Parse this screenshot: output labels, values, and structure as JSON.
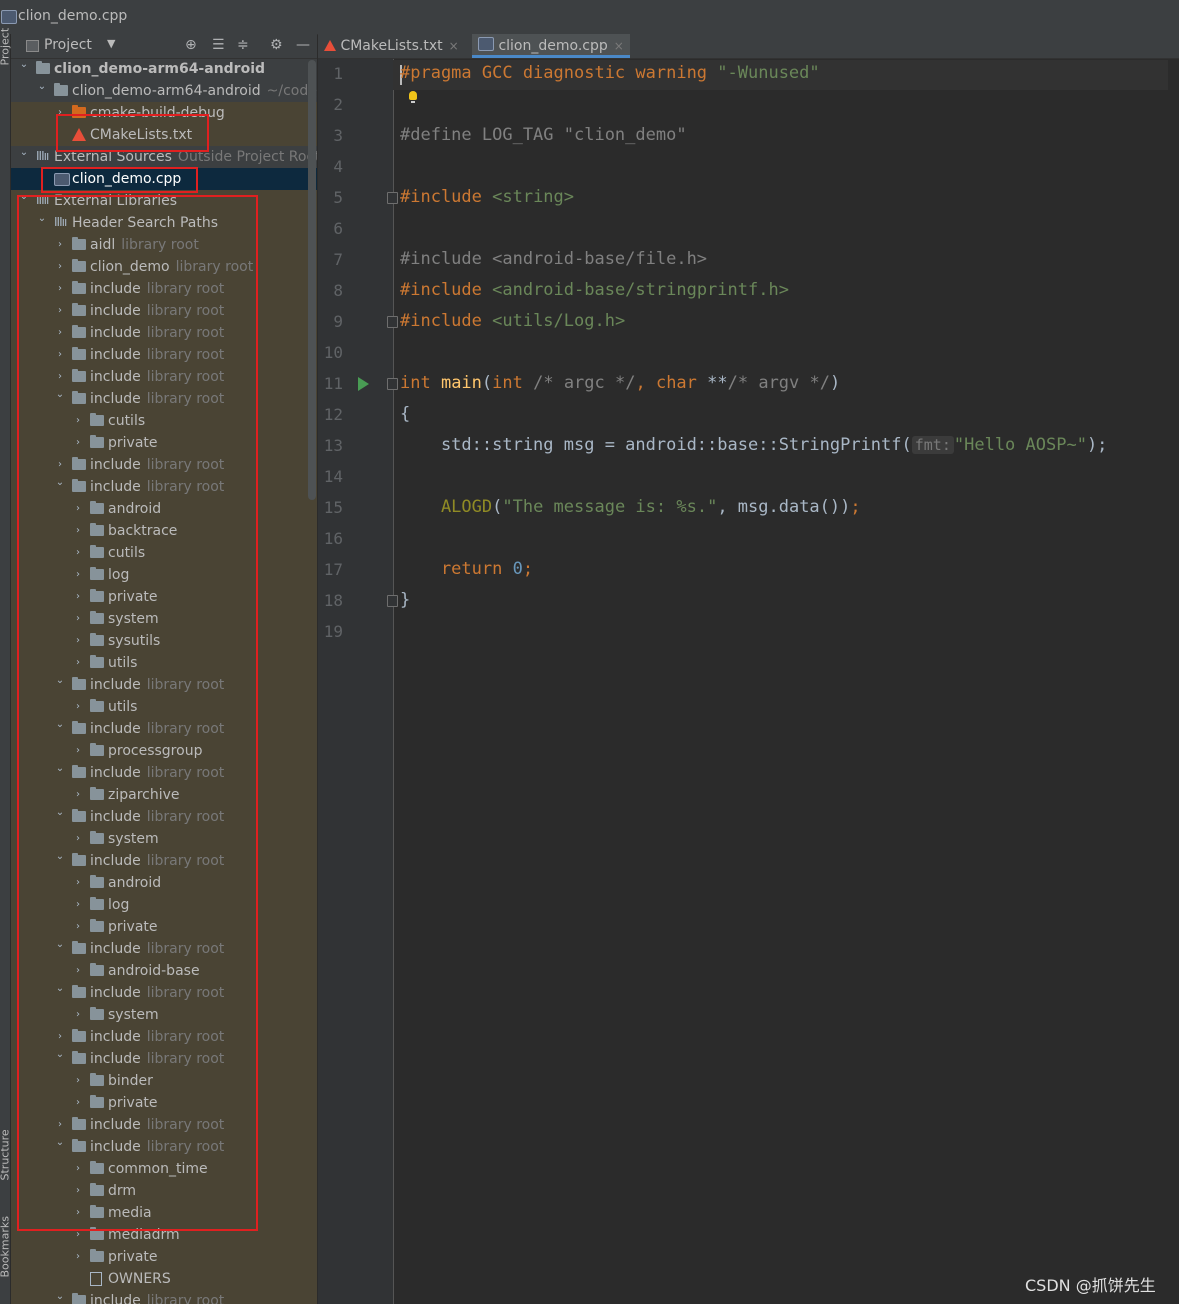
{
  "window": {
    "title": "clion_demo.cpp"
  },
  "side_strip": {
    "project": "Project",
    "structure": "Structure",
    "bookmarks": "Bookmarks"
  },
  "project_panel": {
    "title": "Project",
    "dropdown_icon": "caret-down-icon",
    "toolbar_icons": [
      "locate-icon",
      "expand-all-icon",
      "collapse-all-icon",
      "gear-icon",
      "minimize-icon"
    ],
    "tree": [
      {
        "name": "clion_demo-arm64-android",
        "hint": "",
        "icon": "module-folder"
      },
      {
        "name": "clion_demo-arm64-android",
        "hint": "~/code/c",
        "icon": "folder"
      },
      {
        "name": "cmake-build-debug",
        "hint": "",
        "icon": "excluded-folder"
      },
      {
        "name": "CMakeLists.txt",
        "hint": "",
        "icon": "cmake-file"
      },
      {
        "name": "External Sources",
        "hint": "Outside Project Root",
        "icon": "libraries"
      },
      {
        "name": "clion_demo.cpp",
        "hint": "",
        "icon": "cpp-file"
      },
      {
        "name": "External Libraries",
        "hint": "",
        "icon": "libraries"
      },
      {
        "name": "Header Search Paths",
        "hint": "",
        "icon": "libraries"
      },
      {
        "name": "aidl",
        "hint": "library root",
        "icon": "folder"
      },
      {
        "name": "clion_demo",
        "hint": "library root",
        "icon": "folder"
      },
      {
        "name": "include",
        "hint": "library root",
        "icon": "folder"
      },
      {
        "name": "include",
        "hint": "library root",
        "icon": "folder"
      },
      {
        "name": "include",
        "hint": "library root",
        "icon": "folder"
      },
      {
        "name": "include",
        "hint": "library root",
        "icon": "folder"
      },
      {
        "name": "include",
        "hint": "library root",
        "icon": "folder"
      },
      {
        "name": "include",
        "hint": "library root",
        "icon": "folder"
      },
      {
        "name": "cutils",
        "hint": "",
        "icon": "folder"
      },
      {
        "name": "private",
        "hint": "",
        "icon": "folder"
      },
      {
        "name": "include",
        "hint": "library root",
        "icon": "folder"
      },
      {
        "name": "include",
        "hint": "library root",
        "icon": "folder"
      },
      {
        "name": "android",
        "hint": "",
        "icon": "folder"
      },
      {
        "name": "backtrace",
        "hint": "",
        "icon": "folder"
      },
      {
        "name": "cutils",
        "hint": "",
        "icon": "folder"
      },
      {
        "name": "log",
        "hint": "",
        "icon": "folder"
      },
      {
        "name": "private",
        "hint": "",
        "icon": "folder"
      },
      {
        "name": "system",
        "hint": "",
        "icon": "folder"
      },
      {
        "name": "sysutils",
        "hint": "",
        "icon": "folder"
      },
      {
        "name": "utils",
        "hint": "",
        "icon": "folder"
      },
      {
        "name": "include",
        "hint": "library root",
        "icon": "folder"
      },
      {
        "name": "utils",
        "hint": "",
        "icon": "folder"
      },
      {
        "name": "include",
        "hint": "library root",
        "icon": "folder"
      },
      {
        "name": "processgroup",
        "hint": "",
        "icon": "folder"
      },
      {
        "name": "include",
        "hint": "library root",
        "icon": "folder"
      },
      {
        "name": "ziparchive",
        "hint": "",
        "icon": "folder"
      },
      {
        "name": "include",
        "hint": "library root",
        "icon": "folder"
      },
      {
        "name": "system",
        "hint": "",
        "icon": "folder"
      },
      {
        "name": "include",
        "hint": "library root",
        "icon": "folder"
      },
      {
        "name": "android",
        "hint": "",
        "icon": "folder"
      },
      {
        "name": "log",
        "hint": "",
        "icon": "folder"
      },
      {
        "name": "private",
        "hint": "",
        "icon": "folder"
      },
      {
        "name": "include",
        "hint": "library root",
        "icon": "folder"
      },
      {
        "name": "android-base",
        "hint": "",
        "icon": "folder"
      },
      {
        "name": "include",
        "hint": "library root",
        "icon": "folder"
      },
      {
        "name": "system",
        "hint": "",
        "icon": "folder"
      },
      {
        "name": "include",
        "hint": "library root",
        "icon": "folder"
      },
      {
        "name": "include",
        "hint": "library root",
        "icon": "folder"
      },
      {
        "name": "binder",
        "hint": "",
        "icon": "folder"
      },
      {
        "name": "private",
        "hint": "",
        "icon": "folder"
      },
      {
        "name": "include",
        "hint": "library root",
        "icon": "folder"
      },
      {
        "name": "include",
        "hint": "library root",
        "icon": "folder"
      },
      {
        "name": "common_time",
        "hint": "",
        "icon": "folder"
      },
      {
        "name": "drm",
        "hint": "",
        "icon": "folder"
      },
      {
        "name": "media",
        "hint": "",
        "icon": "folder"
      },
      {
        "name": "mediadrm",
        "hint": "",
        "icon": "folder"
      },
      {
        "name": "private",
        "hint": "",
        "icon": "folder"
      },
      {
        "name": "OWNERS",
        "hint": "",
        "icon": "text-file"
      },
      {
        "name": "include",
        "hint": "library root",
        "icon": "folder"
      }
    ]
  },
  "tabs": [
    {
      "label": "CMakeLists.txt",
      "icon": "cmake-icon",
      "active": false
    },
    {
      "label": "clion_demo.cpp",
      "icon": "cpp-file-icon",
      "active": true
    }
  ],
  "editor": {
    "line_numbers": [
      "1",
      "2",
      "3",
      "4",
      "5",
      "6",
      "7",
      "8",
      "9",
      "10",
      "11",
      "12",
      "13",
      "14",
      "15",
      "16",
      "17",
      "18",
      "19"
    ],
    "code": {
      "l1_a": "#pragma GCC diagnostic warning ",
      "l1_b": "\"-Wunused\"",
      "l3": "#define LOG_TAG \"clion_demo\"",
      "l5_a": "#include ",
      "l5_b": "<string>",
      "l7": "#include <android-base/file.h>",
      "l8_a": "#include ",
      "l8_b": "<android-base/stringprintf.h>",
      "l9_a": "#include ",
      "l9_b": "<utils/Log.h>",
      "l11_int": "int",
      "l11_main": " main",
      "l11_p1": "(",
      "l11_int2": "int",
      "l11_cm1": " /* argc */",
      "l11_comma": ", ",
      "l11_char": "char",
      "l11_ptr": " **",
      "l11_cm2": "/* argv */",
      "l11_p2": ")",
      "l12": "{",
      "l13_a": "    std::string msg = android::base::StringPrintf(",
      "l13_hint": "fmt:",
      "l13_str": "\"Hello AOSP~\"",
      "l13_end": ");",
      "l15_mac": "    ALOGD",
      "l15_p1": "(",
      "l15_str": "\"The message is: %s.\"",
      "l15_rest": ", msg.data())",
      "l15_semi": ";",
      "l17_kw": "    return",
      "l17_num": " 0",
      "l17_semi": ";",
      "l18": "}"
    }
  },
  "watermark": "CSDN @抓饼先生",
  "colors": {
    "highlight_box": "#e02020",
    "keyword": "#cc7832",
    "string": "#6a8759",
    "selection": "#0d293e"
  }
}
